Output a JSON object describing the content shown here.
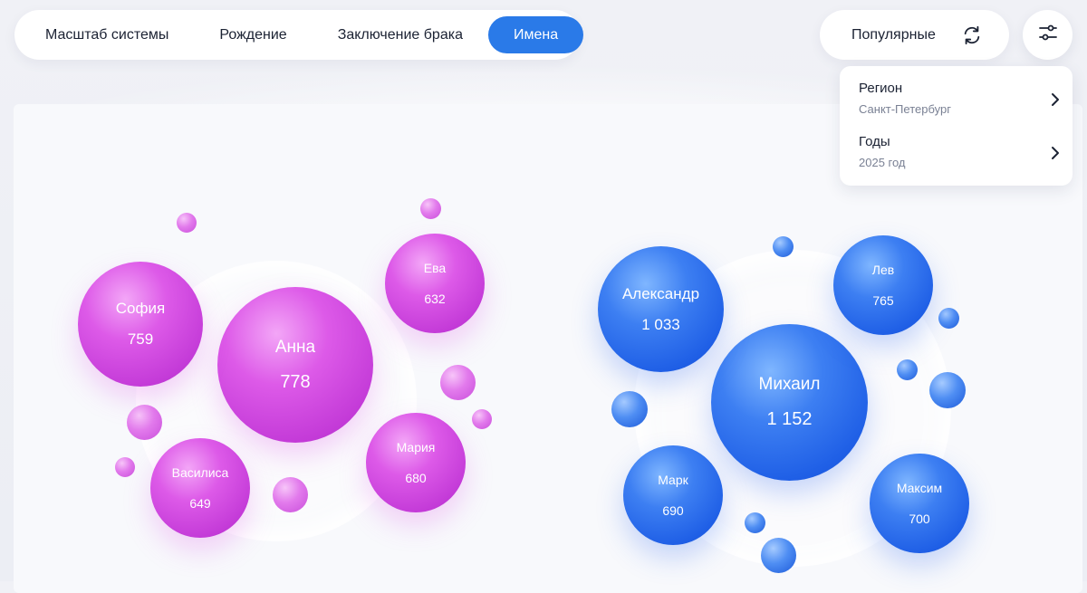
{
  "tabs": [
    {
      "label": "Масштаб системы"
    },
    {
      "label": "Рождение"
    },
    {
      "label": "Заключение брака"
    },
    {
      "label": "Имена",
      "active": true
    }
  ],
  "popular": {
    "label": "Популярные",
    "icon": "refresh-icon"
  },
  "filter": {
    "icon": "filter-sliders-icon"
  },
  "filters_dropdown": {
    "region": {
      "title": "Регион",
      "value": "Санкт-Петербург"
    },
    "years": {
      "title": "Годы",
      "value": "2025 год"
    }
  },
  "colors": {
    "accent": "#2a7ae8",
    "female": "#dd5ae8",
    "male": "#2f6ff0"
  },
  "female_names": [
    {
      "name": "Анна",
      "count": "778"
    },
    {
      "name": "София",
      "count": "759"
    },
    {
      "name": "Мария",
      "count": "680"
    },
    {
      "name": "Василиса",
      "count": "649"
    },
    {
      "name": "Ева",
      "count": "632"
    }
  ],
  "male_names": [
    {
      "name": "Михаил",
      "count": "1 152"
    },
    {
      "name": "Александр",
      "count": "1 033"
    },
    {
      "name": "Лев",
      "count": "765"
    },
    {
      "name": "Максим",
      "count": "700"
    },
    {
      "name": "Марк",
      "count": "690"
    }
  ]
}
